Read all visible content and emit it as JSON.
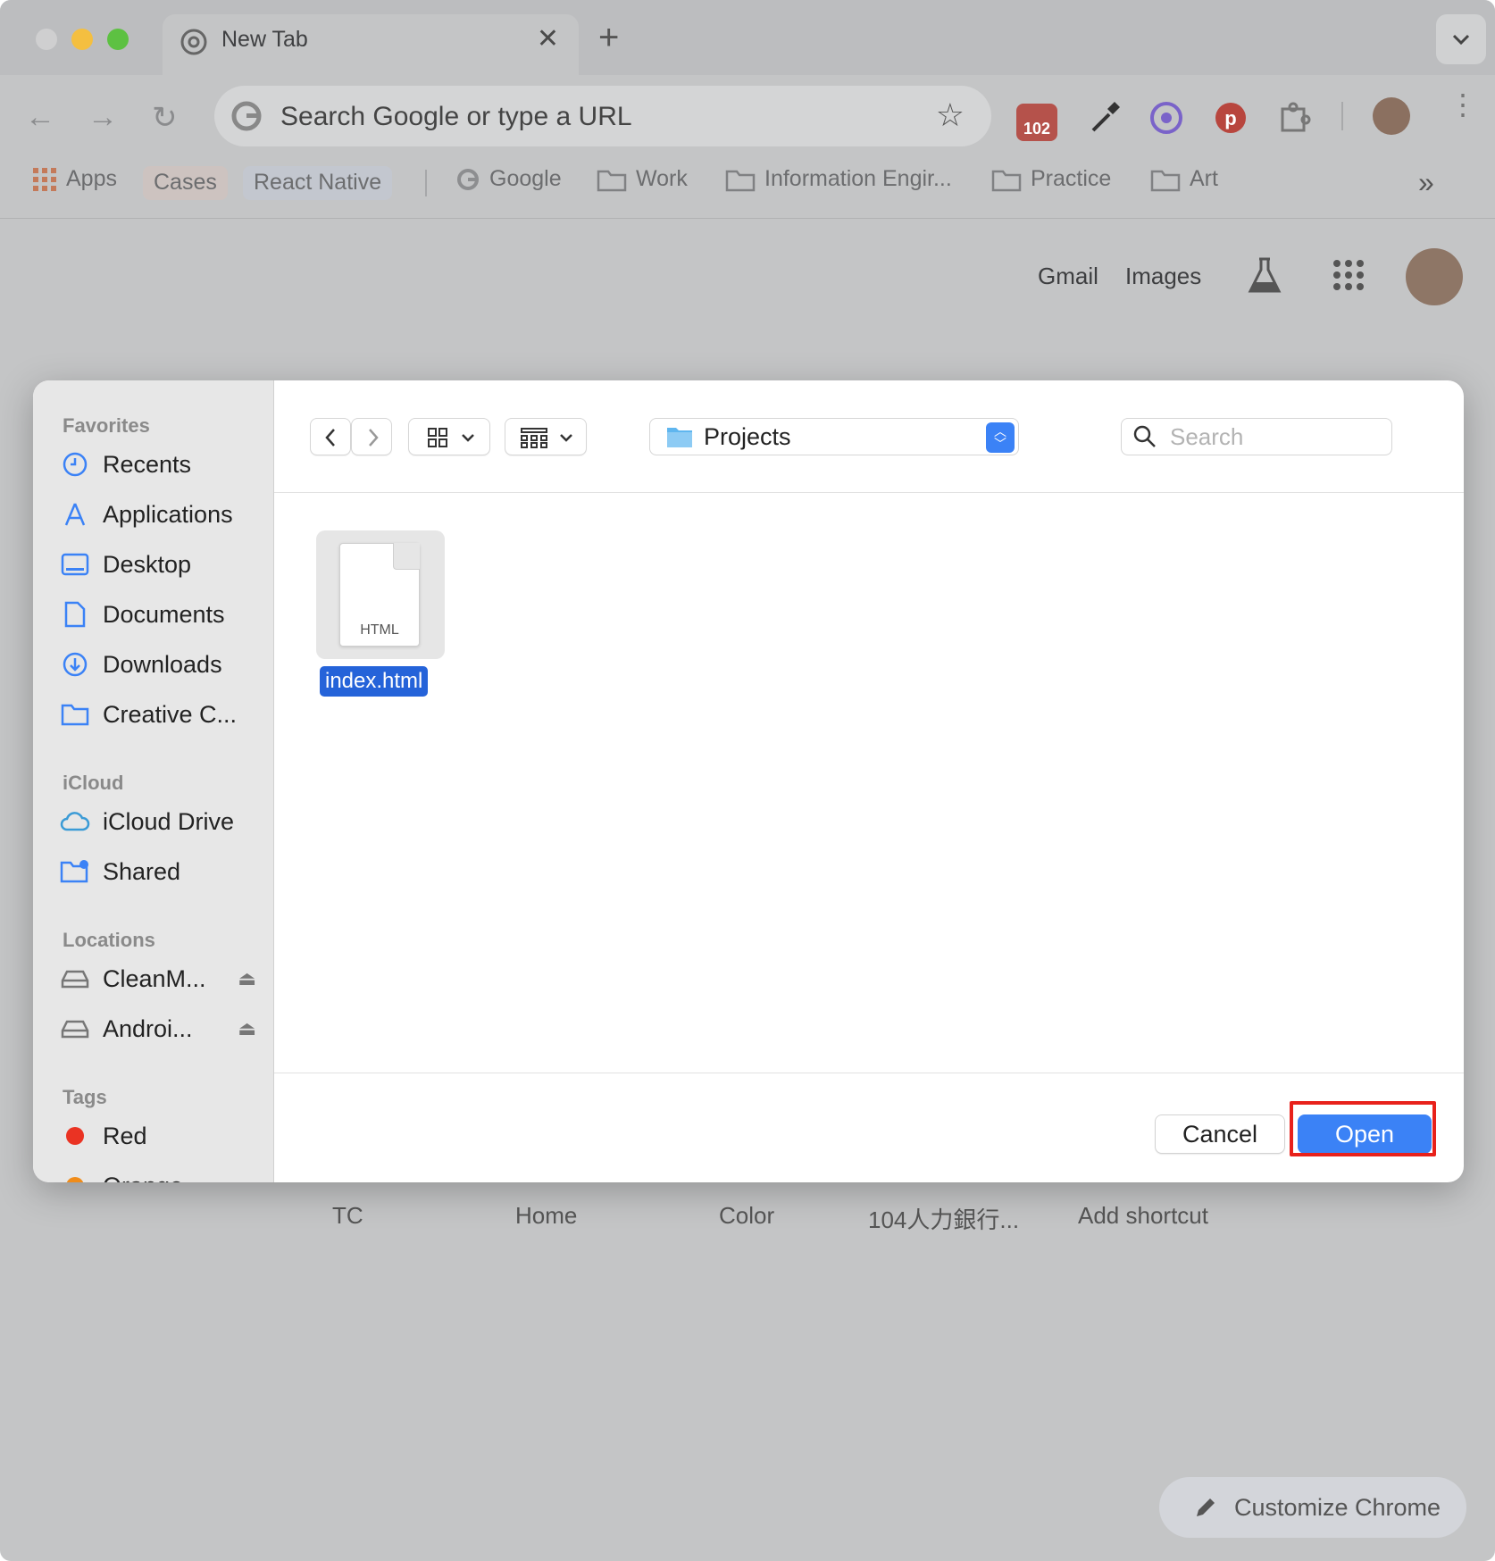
{
  "browser": {
    "tab_title": "New Tab",
    "omnibox_placeholder": "Search Google or type a URL",
    "extension_badge": "102",
    "bookmarks": {
      "apps": "Apps",
      "cases": "Cases",
      "react_native": "React Native",
      "google": "Google",
      "work": "Work",
      "info_eng": "Information Engir...",
      "practice": "Practice",
      "art": "Art",
      "overflow": "»"
    },
    "ntp_links": {
      "gmail": "Gmail",
      "images": "Images"
    },
    "shortcuts": [
      "TC",
      "Home",
      "Color",
      "104人力銀行...",
      "Add shortcut"
    ],
    "customize_label": "Customize Chrome"
  },
  "dialog": {
    "sidebar": {
      "favorites_heading": "Favorites",
      "favorites": [
        "Recents",
        "Applications",
        "Desktop",
        "Documents",
        "Downloads",
        "Creative C..."
      ],
      "icloud_heading": "iCloud",
      "icloud": [
        "iCloud Drive",
        "Shared"
      ],
      "locations_heading": "Locations",
      "locations": [
        "CleanM...",
        "Androi..."
      ],
      "tags_heading": "Tags",
      "tags": [
        "Red",
        "Orange"
      ]
    },
    "current_folder": "Projects",
    "search_placeholder": "Search",
    "files": [
      {
        "name": "index.html",
        "kind": "HTML"
      }
    ],
    "cancel_label": "Cancel",
    "open_label": "Open"
  },
  "colors": {
    "accent": "#3b82f6",
    "selection": "#2563d9",
    "highlight_box": "#e8211b",
    "tag_red": "#ea3323",
    "tag_orange": "#f08c1a"
  }
}
